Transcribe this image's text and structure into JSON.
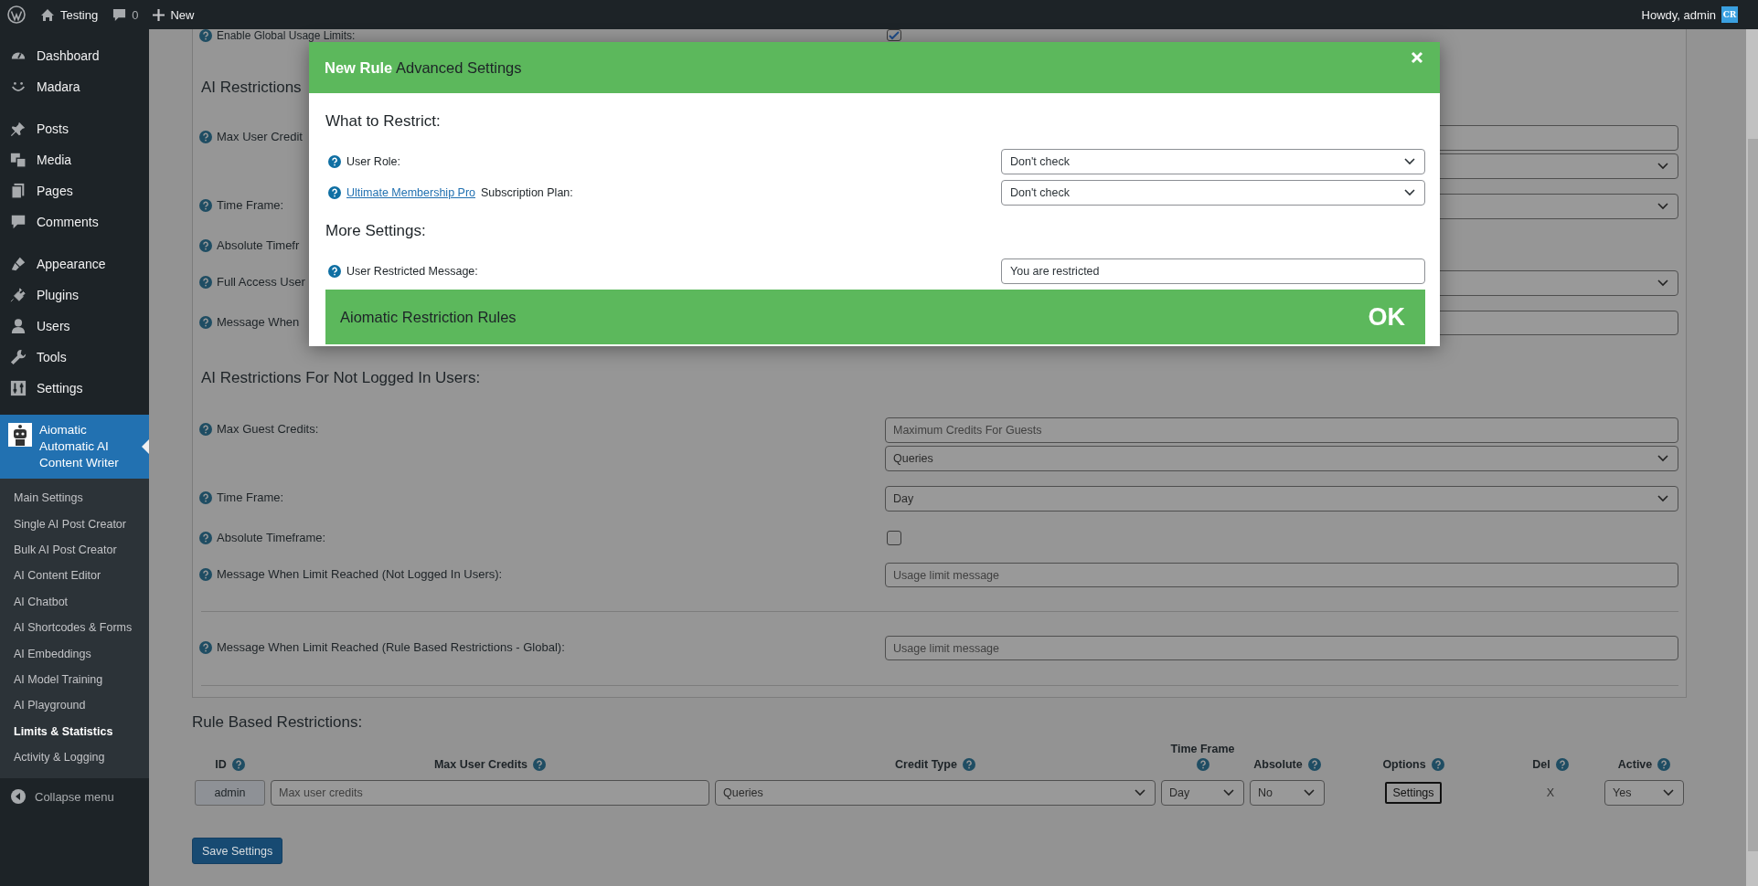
{
  "admin_bar": {
    "site_name": "Testing",
    "comments_count": "0",
    "new_label": "New",
    "greeting": "Howdy, admin",
    "avatar_text": "CR"
  },
  "sidebar": {
    "groups": [
      [
        {
          "label": "Dashboard",
          "kind": "dashboard"
        },
        {
          "label": "Madara",
          "kind": "smile"
        }
      ],
      [
        {
          "label": "Posts",
          "kind": "pin"
        },
        {
          "label": "Media",
          "kind": "media"
        },
        {
          "label": "Pages",
          "kind": "pages"
        },
        {
          "label": "Comments",
          "kind": "comment"
        }
      ],
      [
        {
          "label": "Appearance",
          "kind": "brush"
        },
        {
          "label": "Plugins",
          "kind": "plug"
        },
        {
          "label": "Users",
          "kind": "user"
        },
        {
          "label": "Tools",
          "kind": "wrench"
        },
        {
          "label": "Settings",
          "kind": "sliders"
        }
      ]
    ],
    "current_menu": {
      "label": "Aiomatic Automatic AI Content Writer",
      "submenu": [
        {
          "label": "Main Settings",
          "selected": false
        },
        {
          "label": "Single AI Post Creator",
          "selected": false
        },
        {
          "label": "Bulk AI Post Creator",
          "selected": false
        },
        {
          "label": "AI Content Editor",
          "selected": false
        },
        {
          "label": "AI Chatbot",
          "selected": false
        },
        {
          "label": "AI Shortcodes & Forms",
          "selected": false
        },
        {
          "label": "AI Embeddings",
          "selected": false
        },
        {
          "label": "AI Model Training",
          "selected": false
        },
        {
          "label": "AI Playground",
          "selected": false
        },
        {
          "label": "Limits & Statistics",
          "selected": true
        },
        {
          "label": "Activity & Logging",
          "selected": false
        }
      ]
    },
    "collapse_label": "Collapse menu"
  },
  "global_limits": {
    "label": "Enable Global Usage Limits:",
    "checked": true
  },
  "logged_in_section": {
    "title": "AI Restrictions",
    "rows": [
      {
        "label": "Max User Credit",
        "fields": [
          {
            "kind": "input"
          },
          {
            "kind": "select"
          }
        ]
      },
      {
        "label": "Time Frame:",
        "fields": [
          {
            "kind": "select"
          }
        ]
      },
      {
        "label": "Absolute Timefr"
      },
      {
        "label": "Full Access User",
        "fields": [
          {
            "kind": "select"
          }
        ]
      },
      {
        "label": "Message When",
        "fields": [
          {
            "kind": "textarea"
          }
        ]
      }
    ]
  },
  "not_logged_section": {
    "title": "AI Restrictions For Not Logged In Users:",
    "rows": [
      {
        "label": "Max Guest Credits:",
        "fields": [
          {
            "kind": "input",
            "placeholder": "Maximum Credits For Guests"
          },
          {
            "kind": "select",
            "value": "Queries"
          }
        ]
      },
      {
        "label": "Time Frame:",
        "fields": [
          {
            "kind": "select",
            "value": "Day"
          }
        ]
      },
      {
        "label": "Absolute Timeframe:",
        "fields": [
          {
            "kind": "checkbox",
            "checked": false
          }
        ]
      },
      {
        "label": "Message When Limit Reached (Not Logged In Users):",
        "fields": [
          {
            "kind": "textarea",
            "placeholder": "Usage limit message"
          }
        ]
      },
      {
        "label": "Message When Limit Reached (Rule Based Restrictions - Global):",
        "separated": true,
        "fields": [
          {
            "kind": "textarea",
            "placeholder": "Usage limit message"
          }
        ]
      }
    ]
  },
  "rule_section": {
    "title": "Rule Based Restrictions:",
    "columns": [
      {
        "label": "ID"
      },
      {
        "label": "Max User Credits"
      },
      {
        "label": "Credit Type"
      },
      {
        "label": "Time Frame"
      },
      {
        "label": "Absolute"
      },
      {
        "label": "Options"
      },
      {
        "label": "Del"
      },
      {
        "label": "Active"
      }
    ],
    "rows": [
      {
        "cells": [
          {
            "kind": "button",
            "text": "admin"
          },
          {
            "kind": "input",
            "placeholder": "Max user credits"
          },
          {
            "kind": "select",
            "value": "Queries"
          },
          {
            "kind": "select",
            "value": "Day"
          },
          {
            "kind": "select",
            "value": "No"
          },
          {
            "kind": "outline_button",
            "text": "Settings"
          },
          {
            "kind": "text",
            "text": "X"
          },
          {
            "kind": "select",
            "value": "Yes"
          }
        ]
      }
    ]
  },
  "save_button": "Save Settings",
  "modal": {
    "title": "**New Rule** Advanced Settings",
    "sections": [
      {
        "heading": "What to Restrict:",
        "rows": [
          {
            "label": "User Role:",
            "field": {
              "kind": "select",
              "value": "Don't check"
            }
          },
          {
            "link": "Ultimate Membership Pro",
            "label": "Subscription Plan:",
            "field": {
              "kind": "select",
              "value": "Don't check"
            }
          }
        ]
      },
      {
        "heading": "More Settings:",
        "rows": [
          {
            "label": "User Restricted Message:",
            "field": {
              "kind": "input",
              "value": "You are restricted"
            }
          }
        ]
      }
    ],
    "footer_title": "Aiomatic Restriction Rules",
    "ok_label": "OK"
  }
}
